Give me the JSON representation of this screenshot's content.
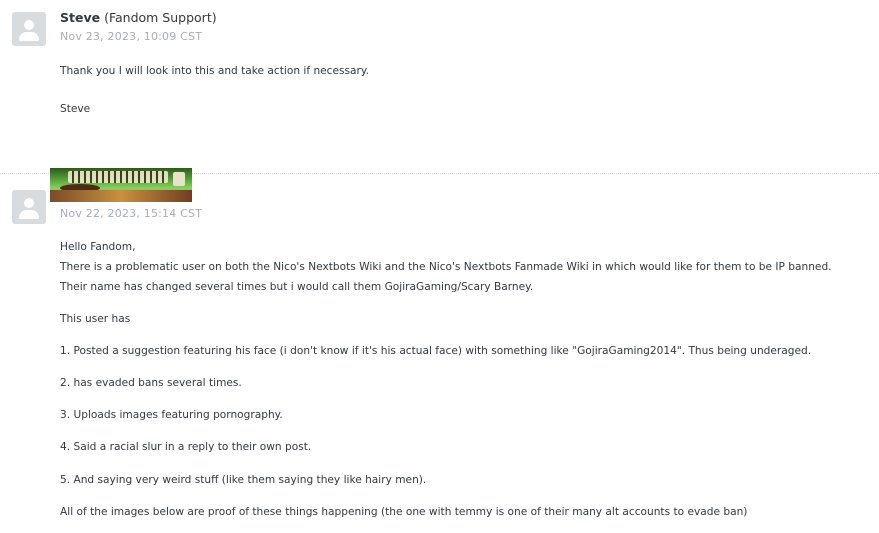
{
  "messages": [
    {
      "author_name": "Steve",
      "author_org": "(Fandom Support)",
      "timestamp": "Nov 23, 2023, 10:09 CST",
      "body": [
        "Thank you I will look into this and take action if necessary.",
        "Steve"
      ]
    },
    {
      "timestamp": "Nov 22, 2023, 15:14 CST",
      "body": [
        "Hello Fandom,",
        "There is a problematic user on both the Nico's Nextbots Wiki and the Nico's Nextbots Fanmade Wiki in which would like for them to be IP banned.",
        "Their name has changed several times but i would call them GojiraGaming/Scary Barney.",
        "This user has",
        "1. Posted a suggestion featuring his face (i don't know if it's his actual face) with something like \"GojiraGaming2014\". Thus being underaged.",
        "2. has evaded bans several times.",
        "3. Uploads images featuring pornography.",
        "4. Said a racial slur in a reply to their own post.",
        "5. And saying very weird stuff (like them saying they like hairy men).",
        "All of the images below are proof of these things happening (the one with temmy is one of their many alt accounts to evade ban)"
      ]
    }
  ],
  "icons": {
    "avatar": "user-placeholder-icon"
  }
}
